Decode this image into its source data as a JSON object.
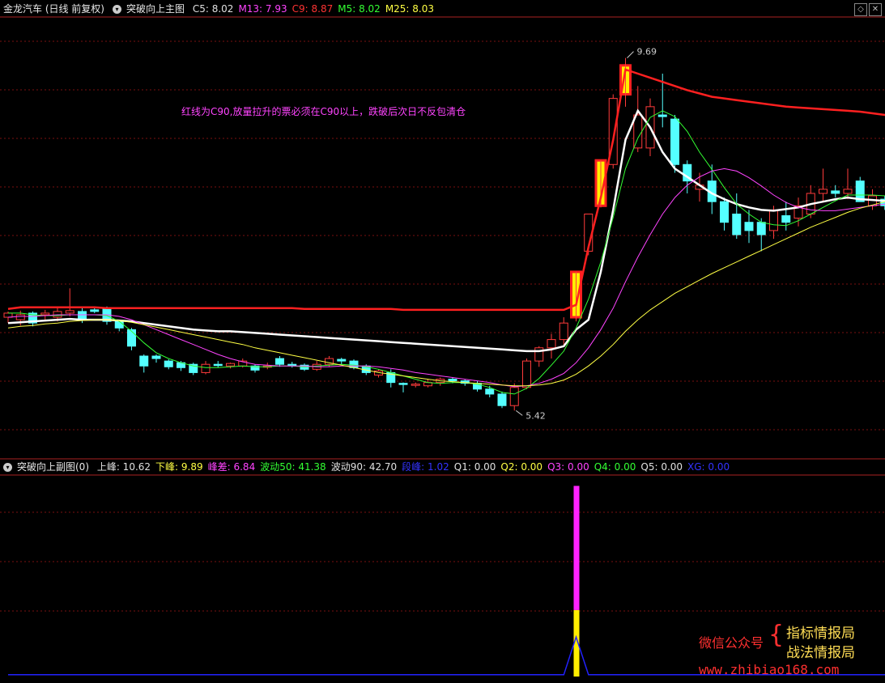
{
  "main_header": {
    "title": "金龙汽车 (日线 前复权)",
    "indicator": "突破向上主图",
    "fields": [
      {
        "label": "C5:",
        "value": "8.02",
        "color": "#e0e0e0"
      },
      {
        "label": "M13:",
        "value": "7.93",
        "color": "#ff44ff"
      },
      {
        "label": "C9:",
        "value": "8.87",
        "color": "#ff3333"
      },
      {
        "label": "M5:",
        "value": "8.02",
        "color": "#33ff33"
      },
      {
        "label": "M25:",
        "value": "8.03",
        "color": "#ffff44"
      }
    ]
  },
  "sub_header": {
    "indicator": "突破向上副图(0)",
    "fields": [
      {
        "label": "上峰:",
        "value": "10.62",
        "color": "#e0e0e0"
      },
      {
        "label": "下峰:",
        "value": "9.89",
        "color": "#ffff44"
      },
      {
        "label": "峰差:",
        "value": "6.84",
        "color": "#ff44ff"
      },
      {
        "label": "波动50:",
        "value": "41.38",
        "color": "#33ff33"
      },
      {
        "label": "波动90:",
        "value": "42.70",
        "color": "#e0e0e0"
      },
      {
        "label": "段峰:",
        "value": "1.02",
        "color": "#3333ff"
      },
      {
        "label": "Q1:",
        "value": "0.00",
        "color": "#e0e0e0"
      },
      {
        "label": "Q2:",
        "value": "0.00",
        "color": "#ffff44"
      },
      {
        "label": "Q3:",
        "value": "0.00",
        "color": "#ff44ff"
      },
      {
        "label": "Q4:",
        "value": "0.00",
        "color": "#33ff33"
      },
      {
        "label": "Q5:",
        "value": "0.00",
        "color": "#e0e0e0"
      },
      {
        "label": "XG:",
        "value": "0.00",
        "color": "#3333ff"
      }
    ]
  },
  "annotation": "红线为C90,放量拉升的票必须在C90以上，跌破后次日不反包清仓",
  "watermark": {
    "left": "微信公众号",
    "right1": "指标情报局",
    "right2": "战法情报局",
    "url": "www.zhibiao168.com"
  },
  "chart_data": {
    "type": "candlestick",
    "high_label": "9.69",
    "low_label": "5.42",
    "ylim": [
      5.1,
      10.0
    ],
    "candles": [
      [
        6.55,
        6.62,
        6.48,
        6.6
      ],
      [
        6.52,
        6.63,
        6.45,
        6.58
      ],
      [
        6.6,
        6.62,
        6.44,
        6.48
      ],
      [
        6.58,
        6.64,
        6.52,
        6.6
      ],
      [
        6.55,
        6.68,
        6.5,
        6.62
      ],
      [
        6.6,
        6.9,
        6.56,
        6.63
      ],
      [
        6.62,
        6.66,
        6.48,
        6.52
      ],
      [
        6.64,
        6.68,
        6.6,
        6.62
      ],
      [
        6.66,
        6.68,
        6.46,
        6.5
      ],
      [
        6.5,
        6.52,
        6.38,
        6.42
      ],
      [
        6.4,
        6.42,
        6.15,
        6.2
      ],
      [
        6.08,
        6.1,
        5.88,
        5.96
      ],
      [
        6.08,
        6.1,
        6.0,
        6.05
      ],
      [
        6.02,
        6.04,
        5.92,
        5.95
      ],
      [
        6.0,
        6.02,
        5.9,
        5.94
      ],
      [
        5.98,
        6.0,
        5.85,
        5.88
      ],
      [
        5.88,
        6.02,
        5.86,
        5.98
      ],
      [
        5.98,
        6.02,
        5.94,
        5.97
      ],
      [
        5.96,
        6.0,
        5.93,
        5.99
      ],
      [
        5.96,
        6.05,
        5.94,
        6.02
      ],
      [
        5.96,
        5.98,
        5.88,
        5.91
      ],
      [
        5.96,
        6.0,
        5.92,
        5.96
      ],
      [
        6.05,
        6.08,
        5.95,
        5.98
      ],
      [
        5.98,
        6.01,
        5.94,
        5.97
      ],
      [
        5.97,
        5.99,
        5.9,
        5.92
      ],
      [
        5.92,
        6.02,
        5.9,
        5.98
      ],
      [
        5.98,
        6.08,
        5.95,
        6.05
      ],
      [
        6.04,
        6.06,
        5.98,
        6.02
      ],
      [
        6.02,
        6.04,
        5.92,
        5.94
      ],
      [
        5.96,
        5.98,
        5.85,
        5.88
      ],
      [
        5.85,
        5.92,
        5.82,
        5.9
      ],
      [
        5.88,
        5.92,
        5.7,
        5.76
      ],
      [
        5.75,
        5.76,
        5.64,
        5.74
      ],
      [
        5.73,
        5.76,
        5.7,
        5.74
      ],
      [
        5.72,
        5.8,
        5.7,
        5.76
      ],
      [
        5.76,
        5.82,
        5.72,
        5.8
      ],
      [
        5.8,
        5.82,
        5.75,
        5.78
      ],
      [
        5.78,
        5.8,
        5.72,
        5.75
      ],
      [
        5.75,
        5.78,
        5.65,
        5.68
      ],
      [
        5.68,
        5.72,
        5.58,
        5.62
      ],
      [
        5.62,
        5.65,
        5.45,
        5.48
      ],
      [
        5.48,
        5.75,
        5.42,
        5.7
      ],
      [
        5.7,
        6.05,
        5.68,
        6.02
      ],
      [
        6.02,
        6.2,
        5.95,
        6.18
      ],
      [
        6.18,
        6.35,
        6.05,
        6.28
      ],
      [
        6.28,
        6.55,
        6.2,
        6.48
      ],
      [
        6.55,
        7.1,
        6.5,
        7.1
      ],
      [
        7.35,
        7.8,
        7.3,
        7.8
      ],
      [
        7.9,
        8.45,
        7.88,
        8.45
      ],
      [
        8.4,
        9.25,
        8.35,
        9.2
      ],
      [
        9.25,
        9.69,
        9.1,
        9.6
      ],
      [
        8.6,
        9.35,
        8.55,
        9.0
      ],
      [
        8.6,
        9.2,
        8.5,
        9.1
      ],
      [
        9.0,
        9.5,
        8.85,
        8.98
      ],
      [
        8.95,
        9.0,
        8.3,
        8.4
      ],
      [
        8.4,
        8.45,
        8.05,
        8.2
      ],
      [
        8.1,
        8.3,
        7.95,
        8.15
      ],
      [
        8.2,
        8.4,
        7.8,
        7.95
      ],
      [
        7.95,
        8.0,
        7.6,
        7.7
      ],
      [
        7.8,
        8.05,
        7.5,
        7.55
      ],
      [
        7.7,
        7.85,
        7.45,
        7.6
      ],
      [
        7.7,
        7.75,
        7.35,
        7.55
      ],
      [
        7.6,
        7.9,
        7.5,
        7.85
      ],
      [
        7.78,
        7.95,
        7.6,
        7.7
      ],
      [
        7.75,
        8.0,
        7.65,
        7.9
      ],
      [
        7.8,
        8.15,
        7.75,
        8.05
      ],
      [
        8.05,
        8.35,
        7.95,
        8.1
      ],
      [
        8.08,
        8.15,
        8.0,
        8.05
      ],
      [
        8.05,
        8.35,
        7.98,
        8.1
      ],
      [
        8.2,
        8.25,
        7.95,
        7.95
      ],
      [
        7.9,
        8.1,
        7.85,
        8.02
      ],
      [
        7.98,
        8.02,
        7.85,
        7.9
      ],
      [
        7.95,
        8.05,
        7.88,
        8.0
      ],
      [
        8.0,
        8.15,
        7.95,
        8.1
      ],
      [
        8.05,
        8.25,
        8.0,
        8.12
      ],
      [
        8.15,
        8.4,
        8.1,
        8.25
      ],
      [
        8.18,
        8.3,
        8.1,
        8.2
      ],
      [
        8.2,
        8.55,
        8.18,
        8.35
      ]
    ],
    "series": [
      {
        "name": "C90",
        "color": "#ff2020",
        "values": [
          6.65,
          6.67,
          6.67,
          6.67,
          6.67,
          6.67,
          6.67,
          6.67,
          6.66,
          6.66,
          6.66,
          6.66,
          6.66,
          6.66,
          6.66,
          6.66,
          6.66,
          6.66,
          6.66,
          6.66,
          6.66,
          6.66,
          6.66,
          6.66,
          6.65,
          6.65,
          6.65,
          6.65,
          6.65,
          6.65,
          6.65,
          6.65,
          6.64,
          6.64,
          6.64,
          6.64,
          6.64,
          6.64,
          6.64,
          6.64,
          6.64,
          6.64,
          6.64,
          6.64,
          6.64,
          6.64,
          6.7,
          7.4,
          8.0,
          8.7,
          9.55,
          9.5,
          9.45,
          9.4,
          9.35,
          9.3,
          9.26,
          9.22,
          9.2,
          9.18,
          9.16,
          9.14,
          9.12,
          9.1,
          9.09,
          9.08,
          9.07,
          9.06,
          9.05,
          9.04,
          9.02,
          9.0,
          8.98,
          8.96,
          8.94,
          8.92,
          8.9,
          8.87
        ]
      },
      {
        "name": "C5",
        "color": "#ffffff",
        "values": [
          6.48,
          6.49,
          6.5,
          6.51,
          6.52,
          6.53,
          6.52,
          6.52,
          6.52,
          6.51,
          6.5,
          6.48,
          6.46,
          6.44,
          6.42,
          6.4,
          6.39,
          6.38,
          6.38,
          6.37,
          6.36,
          6.35,
          6.34,
          6.33,
          6.32,
          6.31,
          6.3,
          6.29,
          6.28,
          6.27,
          6.26,
          6.25,
          6.24,
          6.23,
          6.22,
          6.21,
          6.2,
          6.19,
          6.18,
          6.17,
          6.16,
          6.15,
          6.14,
          6.14,
          6.16,
          6.2,
          6.4,
          6.52,
          7.1,
          7.85,
          8.7,
          9.05,
          8.85,
          8.55,
          8.35,
          8.25,
          8.15,
          8.05,
          7.98,
          7.92,
          7.88,
          7.85,
          7.84,
          7.86,
          7.88,
          7.92,
          7.95,
          7.98,
          8.0,
          7.98,
          7.97,
          7.96,
          7.96,
          7.97,
          7.98,
          8.0,
          8.01,
          8.02
        ]
      },
      {
        "name": "M5",
        "color": "#33ff33",
        "values": [
          6.6,
          6.6,
          6.58,
          6.57,
          6.57,
          6.58,
          6.58,
          6.58,
          6.57,
          6.5,
          6.38,
          6.24,
          6.12,
          6.05,
          6.0,
          5.96,
          5.94,
          5.94,
          5.95,
          5.96,
          5.95,
          5.95,
          5.96,
          5.96,
          5.95,
          5.96,
          5.97,
          5.98,
          5.97,
          5.95,
          5.92,
          5.88,
          5.84,
          5.8,
          5.76,
          5.75,
          5.76,
          5.76,
          5.74,
          5.7,
          5.64,
          5.62,
          5.69,
          5.81,
          5.97,
          6.14,
          6.42,
          6.77,
          7.22,
          7.76,
          8.35,
          8.72,
          8.97,
          9.05,
          8.98,
          8.8,
          8.55,
          8.34,
          8.12,
          7.92,
          7.8,
          7.7,
          7.67,
          7.66,
          7.72,
          7.8,
          7.88,
          7.96,
          8.03,
          8.03,
          8.03,
          8.02,
          8.01,
          8.02,
          8.04,
          8.07,
          8.1,
          8.02
        ]
      },
      {
        "name": "M13",
        "color": "#ff44ff",
        "values": [
          6.55,
          6.56,
          6.56,
          6.57,
          6.58,
          6.58,
          6.58,
          6.58,
          6.58,
          6.56,
          6.52,
          6.46,
          6.4,
          6.34,
          6.28,
          6.22,
          6.16,
          6.1,
          6.05,
          6.01,
          5.98,
          5.97,
          5.96,
          5.96,
          5.96,
          5.95,
          5.95,
          5.96,
          5.96,
          5.96,
          5.95,
          5.93,
          5.91,
          5.88,
          5.86,
          5.84,
          5.82,
          5.8,
          5.78,
          5.76,
          5.73,
          5.71,
          5.72,
          5.75,
          5.8,
          5.87,
          6.0,
          6.18,
          6.4,
          6.66,
          6.98,
          7.28,
          7.55,
          7.8,
          8.0,
          8.15,
          8.25,
          8.32,
          8.35,
          8.32,
          8.24,
          8.14,
          8.03,
          7.94,
          7.88,
          7.85,
          7.84,
          7.84,
          7.86,
          7.88,
          7.9,
          7.92,
          7.93,
          7.95,
          7.96,
          7.97,
          7.95,
          7.93
        ]
      },
      {
        "name": "M25",
        "color": "#ffff44",
        "values": [
          6.42,
          6.44,
          6.45,
          6.47,
          6.48,
          6.5,
          6.51,
          6.52,
          6.52,
          6.51,
          6.49,
          6.46,
          6.43,
          6.4,
          6.37,
          6.34,
          6.31,
          6.28,
          6.25,
          6.22,
          6.18,
          6.15,
          6.12,
          6.09,
          6.06,
          6.03,
          6.0,
          5.97,
          5.94,
          5.91,
          5.88,
          5.86,
          5.84,
          5.82,
          5.8,
          5.78,
          5.77,
          5.76,
          5.75,
          5.74,
          5.73,
          5.72,
          5.72,
          5.73,
          5.75,
          5.79,
          5.86,
          5.96,
          6.08,
          6.22,
          6.38,
          6.52,
          6.64,
          6.74,
          6.84,
          6.92,
          7.0,
          7.08,
          7.15,
          7.22,
          7.29,
          7.36,
          7.43,
          7.5,
          7.57,
          7.64,
          7.7,
          7.76,
          7.82,
          7.87,
          7.91,
          7.95,
          7.98,
          8.0,
          8.01,
          8.02,
          8.03,
          8.03
        ]
      }
    ],
    "signal_bars": [
      {
        "index": 46,
        "color": "#ffee00",
        "border": "#ff2020"
      },
      {
        "index": 48,
        "color": "#ffee00",
        "border": "#ff2020"
      },
      {
        "index": 50,
        "color": "#ffee00",
        "border": "#ff2020"
      }
    ],
    "sub_chart": {
      "ylim": [
        0,
        11
      ],
      "bar_index": 46,
      "bar_top_magenta": 10.62,
      "bar_mid_yellow": 3.7,
      "xg_line": [
        {
          "index": 0,
          "value": 0.1
        },
        {
          "index": 45,
          "value": 0.1
        },
        {
          "index": 46,
          "value": 2.2
        },
        {
          "index": 47,
          "value": 0.1
        },
        {
          "index": 77,
          "value": 0.1
        }
      ]
    }
  }
}
